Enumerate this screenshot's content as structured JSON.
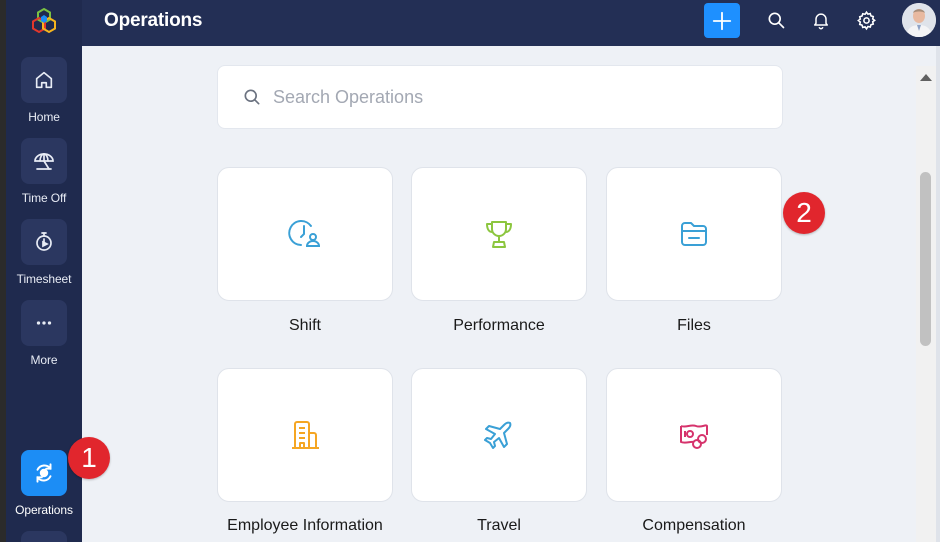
{
  "header": {
    "title": "Operations"
  },
  "sidebar": {
    "items": [
      {
        "label": "Home",
        "icon": "home-icon"
      },
      {
        "label": "Time Off",
        "icon": "beach-umbrella-icon"
      },
      {
        "label": "Timesheet",
        "icon": "stopwatch-icon"
      },
      {
        "label": "More",
        "icon": "more-dots-icon"
      },
      {
        "label": "Operations",
        "icon": "operations-icon",
        "active": true
      }
    ]
  },
  "search": {
    "placeholder": "Search Operations"
  },
  "cards": [
    {
      "label": "Shift",
      "icon": "shift-clock-user-icon",
      "color": "#3aa0d6"
    },
    {
      "label": "Performance",
      "icon": "trophy-icon",
      "color": "#8cc63f"
    },
    {
      "label": "Files",
      "icon": "folder-icon",
      "color": "#3aa0d6"
    },
    {
      "label": "Employee Information",
      "icon": "building-icon",
      "color": "#f5a623"
    },
    {
      "label": "Travel",
      "icon": "airplane-icon",
      "color": "#3aa0d6"
    },
    {
      "label": "Compensation",
      "icon": "money-icon",
      "color": "#d6336c"
    }
  ],
  "badges": [
    "1",
    "2"
  ],
  "colors": {
    "sidebar": "#1f2a4e",
    "topbar": "#232f55",
    "accent": "#1e90ff",
    "badge": "#e1262d"
  }
}
